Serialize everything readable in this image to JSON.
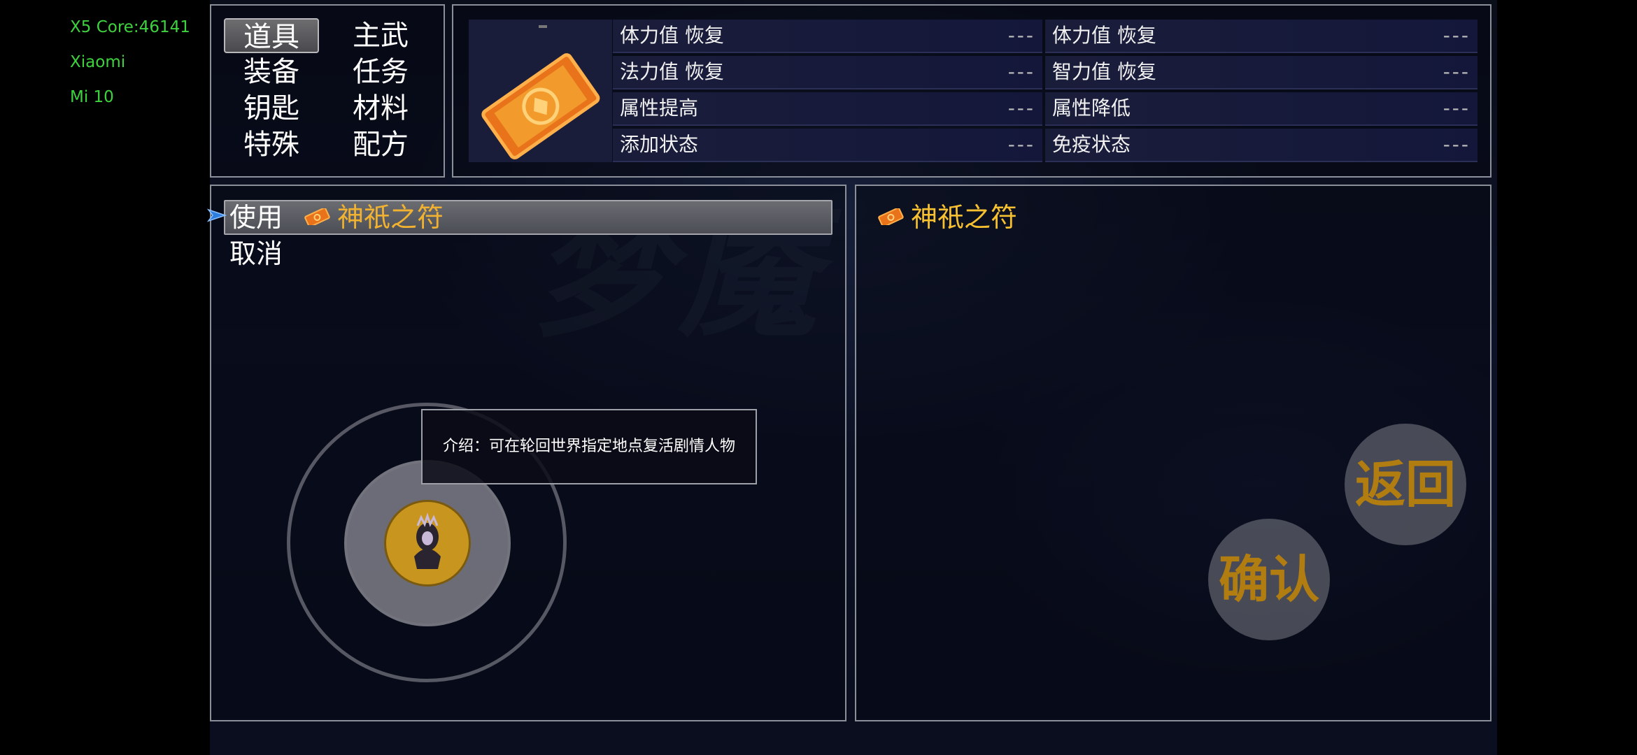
{
  "system": {
    "core": "X5 Core:46141",
    "brand": "Xiaomi",
    "model": "Mi 10"
  },
  "categories": [
    {
      "label": "道具",
      "selected": true
    },
    {
      "label": "主武",
      "selected": false
    },
    {
      "label": "装备",
      "selected": false
    },
    {
      "label": "任务",
      "selected": false
    },
    {
      "label": "钥匙",
      "selected": false
    },
    {
      "label": "材料",
      "selected": false
    },
    {
      "label": "特殊",
      "selected": false
    },
    {
      "label": "配方",
      "selected": false
    }
  ],
  "stats": [
    {
      "label": "体力值 恢复",
      "value": "---"
    },
    {
      "label": "体力值 恢复",
      "value": "---"
    },
    {
      "label": "法力值 恢复",
      "value": "---"
    },
    {
      "label": "智力值 恢复",
      "value": "---"
    },
    {
      "label": "属性提高",
      "value": "---"
    },
    {
      "label": "属性降低",
      "value": "---"
    },
    {
      "label": "添加状态",
      "value": "---"
    },
    {
      "label": "免疫状态",
      "value": "---"
    }
  ],
  "action_menu": {
    "use_label": "使用",
    "item_name": "神祇之符",
    "cancel_label": "取消"
  },
  "detail": {
    "item_name": "神祇之符"
  },
  "tooltip": "介绍：可在轮回世界指定地点复活剧情人物",
  "buttons": {
    "back": "返回",
    "confirm": "确认"
  },
  "colors": {
    "accent_gold": "#f0b230",
    "system_text": "#3fd23f"
  },
  "icons": {
    "item": "talisman-ticket-icon",
    "cursor": "blue-arrow-cursor-icon",
    "joystick": "character-portrait-icon"
  }
}
